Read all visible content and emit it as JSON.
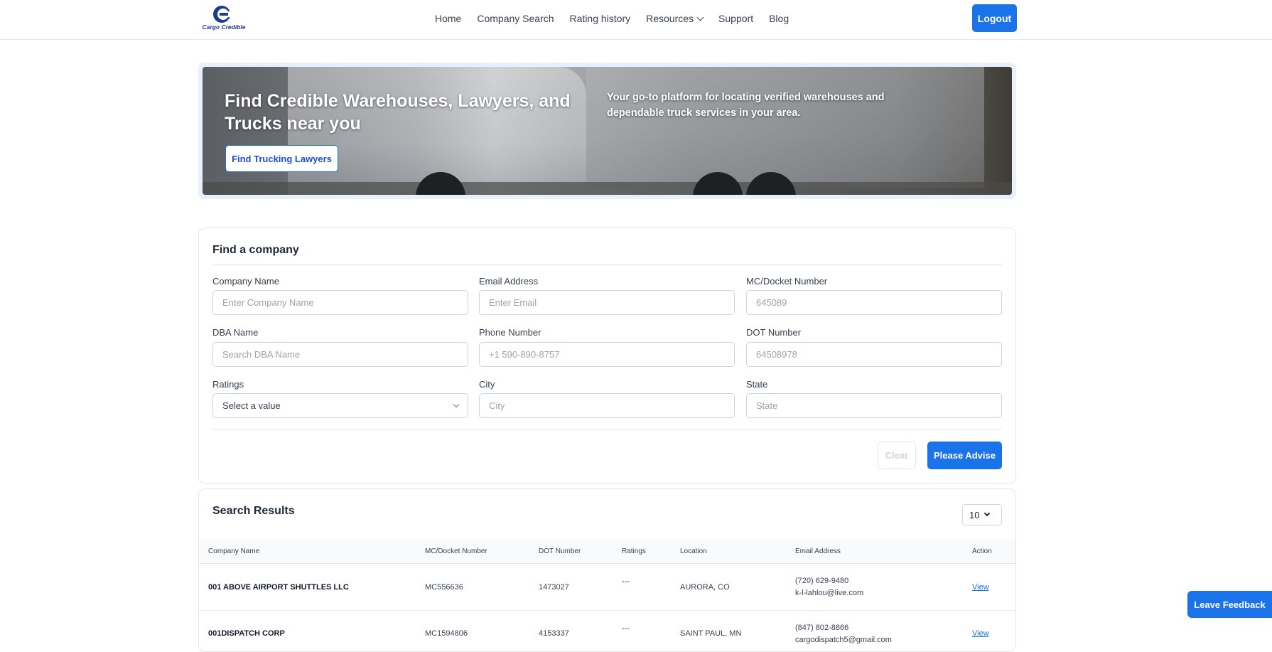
{
  "header": {
    "logo_text": "Cargo Credible",
    "nav": [
      "Home",
      "Company Search",
      "Rating history",
      "Resources",
      "Support",
      "Blog"
    ],
    "logout_label": "Logout"
  },
  "hero": {
    "title": "Find Credible Warehouses, Lawyers, and Trucks near you",
    "button_label": "Find Trucking Lawyers",
    "subtitle": "Your go-to platform for locating verified warehouses and dependable truck services in your area."
  },
  "search_form": {
    "title": "Find a company",
    "company_name": {
      "label": "Company Name",
      "placeholder": "Enter Company Name"
    },
    "email": {
      "label": "Email Address",
      "placeholder": "Enter Email"
    },
    "mc_docket": {
      "label": "MC/Docket Number",
      "placeholder": "645089"
    },
    "dba": {
      "label": "DBA Name",
      "placeholder": "Search DBA Name"
    },
    "phone": {
      "label": "Phone Number",
      "placeholder": "+1 590-890-8757"
    },
    "dot": {
      "label": "DOT Number",
      "placeholder": "64508978"
    },
    "ratings": {
      "label": "Ratings",
      "value": "Select a value"
    },
    "city": {
      "label": "City",
      "placeholder": "City"
    },
    "state": {
      "label": "State",
      "placeholder": "State"
    },
    "clear_label": "Clear",
    "submit_label": "Please Advise"
  },
  "results": {
    "title": "Search Results",
    "page_size": "10",
    "columns": [
      "Company Name",
      "MC/Docket Number",
      "DOT Number",
      "Ratings",
      "Location",
      "Email Address",
      "Action"
    ],
    "rows": [
      {
        "company": "001 ABOVE AIRPORT SHUTTLES LLC",
        "mc": "MC556636",
        "dot": "1473027",
        "ratings": "---",
        "location": "AURORA, CO",
        "phone": "(720) 629-9480",
        "email": "k-l-lahlou@live.com",
        "action": "View"
      },
      {
        "company": "001DISPATCH CORP",
        "mc": "MC1594806",
        "dot": "4153337",
        "ratings": "---",
        "location": "SAINT PAUL, MN",
        "phone": "(847) 802-8866",
        "email": "cargodispatch5@gmail.com",
        "action": "View"
      }
    ]
  },
  "feedback_label": "Leave Feedback",
  "colors": {
    "primary": "#1a73e8",
    "border": "#e5e7eb"
  }
}
